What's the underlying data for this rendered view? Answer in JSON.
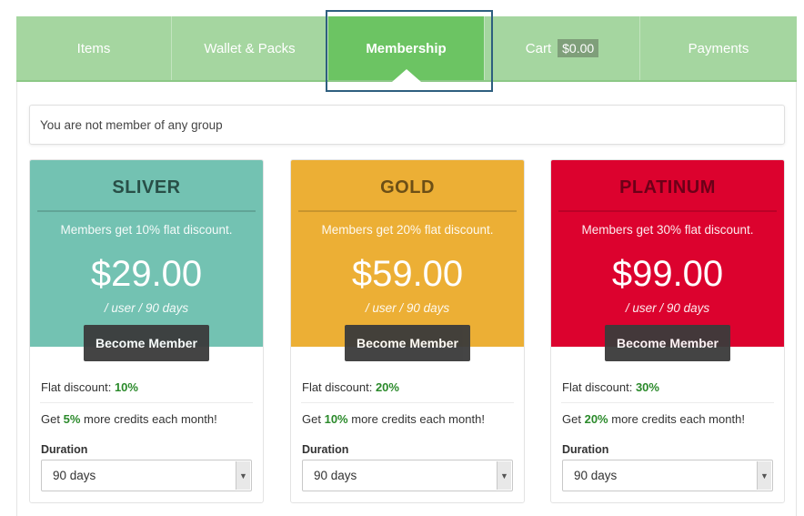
{
  "nav": {
    "items": [
      {
        "label": "Items"
      },
      {
        "label": "Wallet & Packs"
      },
      {
        "label": "Membership"
      },
      {
        "label": "Cart",
        "amount": "$0.00"
      },
      {
        "label": "Payments"
      }
    ],
    "active": "Membership"
  },
  "notice": "You are not member of any group",
  "plans": [
    {
      "name": "SLIVER",
      "description": "Members get 10% flat discount.",
      "price": "$29.00",
      "period": "/ user / 90 days",
      "button": "Become Member",
      "flat_discount_label": "Flat discount:",
      "flat_discount_value": "10%",
      "credits_prefix": "Get",
      "credits_value": "5%",
      "credits_suffix": "more credits each month!",
      "duration_label": "Duration",
      "duration_value": "90 days",
      "color": "#73c2b2"
    },
    {
      "name": "GOLD",
      "description": "Members get 20% flat discount.",
      "price": "$59.00",
      "period": "/ user / 90 days",
      "button": "Become Member",
      "flat_discount_label": "Flat discount:",
      "flat_discount_value": "20%",
      "credits_prefix": "Get",
      "credits_value": "10%",
      "credits_suffix": "more credits each month!",
      "duration_label": "Duration",
      "duration_value": "90 days",
      "color": "#ecaf35"
    },
    {
      "name": "PLATINUM",
      "description": "Members get 30% flat discount.",
      "price": "$99.00",
      "period": "/ user / 90 days",
      "button": "Become Member",
      "flat_discount_label": "Flat discount:",
      "flat_discount_value": "30%",
      "credits_prefix": "Get",
      "credits_value": "20%",
      "credits_suffix": "more credits each month!",
      "duration_label": "Duration",
      "duration_value": "90 days",
      "color": "#dc022e"
    }
  ],
  "colors": {
    "nav_bg": "#a5d6a0",
    "nav_active": "#6cc463",
    "accent_text": "#2b8a2b"
  }
}
